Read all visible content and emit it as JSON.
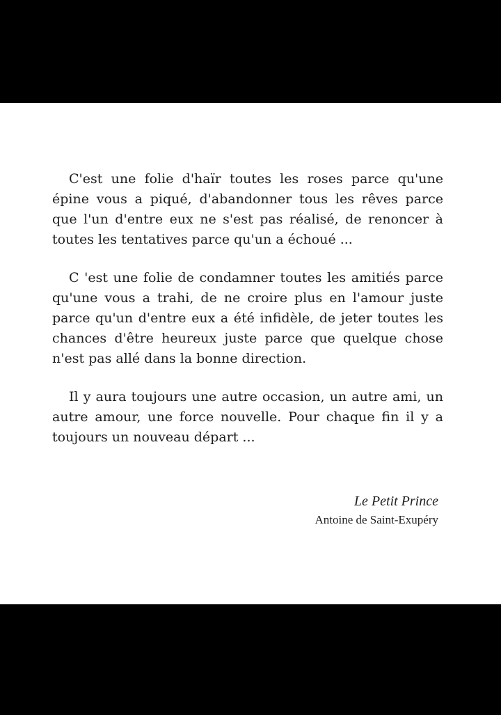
{
  "quote": {
    "paragraphs": [
      "C'est une folie d'haïr toutes les roses parce qu'une épine vous a piqué, d'abandonner tous les rêves parce que l'un d'entre eux ne s'est pas réalisé, de renoncer à toutes les tentatives parce qu'un a échoué ...",
      "C 'est une folie de condamner toutes les amitiés parce qu'une vous a trahi, de ne croire plus en l'amour juste parce qu'un d'entre eux a été infidèle, de jeter toutes les chances d'être heureux juste parce que quelque chose n'est pas allé dans la bonne direction.",
      "Il y aura toujours une autre occasion, un autre ami, un autre amour, une force nouvelle. Pour chaque fin il y a toujours un nouveau départ ..."
    ]
  },
  "attribution": {
    "book": "Le Petit Prince",
    "author": "Antoine de Saint-Exupéry"
  },
  "colors": {
    "frame_background": "#000000",
    "page_background": "#ffffff",
    "text": "#1f1f1f"
  }
}
